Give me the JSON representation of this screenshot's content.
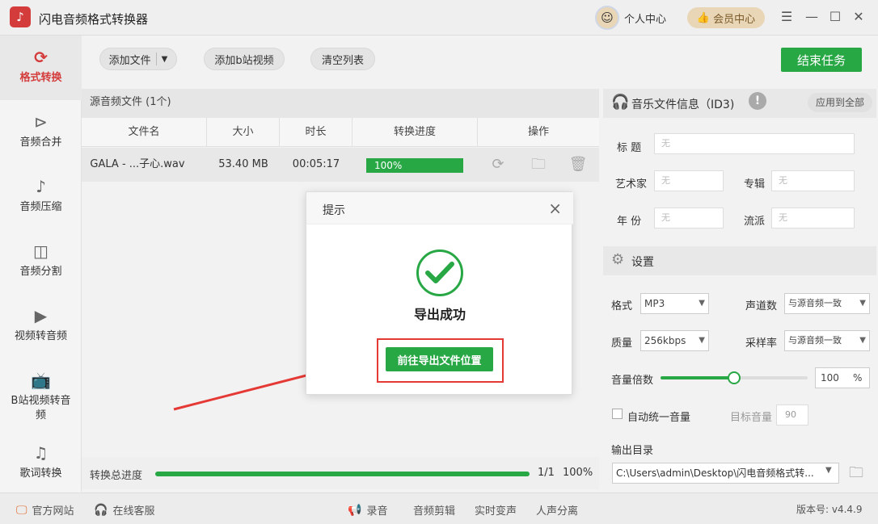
{
  "app": {
    "title": "闪电音频格式转换器",
    "user_center": "个人中心",
    "vip": "会员中心"
  },
  "sidebar": {
    "items": [
      {
        "label": "格式转换"
      },
      {
        "label": "音频合并"
      },
      {
        "label": "音频压缩"
      },
      {
        "label": "音频分割"
      },
      {
        "label": "视频转音频"
      },
      {
        "label": "B站视频转音频"
      },
      {
        "label": "歌词转换"
      }
    ]
  },
  "toolbar": {
    "add_file": "添加文件",
    "add_bilibili": "添加b站视频",
    "clear_list": "清空列表",
    "finish_task": "结束任务"
  },
  "filelist": {
    "header": "源音频文件 (1个)",
    "columns": [
      "文件名",
      "大小",
      "时长",
      "转换进度",
      "操作"
    ],
    "rows": [
      {
        "name": "GALA - ...子心.wav",
        "size": "53.40 MB",
        "duration": "00:05:17",
        "progress": 1.0,
        "progress_label": "100%"
      }
    ]
  },
  "overall": {
    "label": "转换总进度",
    "progress": 1.0,
    "count": "1/1",
    "percent": "100%"
  },
  "id3": {
    "title": "音乐文件信息（ID3)",
    "apply_all": "应用到全部",
    "fields": {
      "title_label": "标 题",
      "artist_label": "艺术家",
      "album_label": "专辑",
      "year_label": "年 份",
      "genre_label": "流派",
      "empty": "无"
    }
  },
  "settings": {
    "title": "设置",
    "format_label": "格式",
    "format_value": "MP3",
    "channels_label": "声道数",
    "channels_value": "与源音频一致",
    "quality_label": "质量",
    "quality_value": "256kbps",
    "samplerate_label": "采样率",
    "samplerate_value": "与源音频一致",
    "volume_label": "音量倍数",
    "volume_value": "100",
    "volume_unit": "%",
    "volume_level": 0.5,
    "auto_volume_label": "自动统一音量",
    "target_volume_label": "目标音量",
    "target_volume_value": "90",
    "output_dir_label": "输出目录",
    "output_dir_value": "C:\\Users\\admin\\Desktop\\闪电音频格式转..."
  },
  "statusbar": {
    "website": "官方网站",
    "service": "在线客服",
    "record": "录音",
    "edit": "音频剪辑",
    "voice_change": "实时变声",
    "vocal_sep": "人声分离",
    "version": "版本号: v4.4.9"
  },
  "dialog": {
    "title": "提示",
    "message": "导出成功",
    "button": "前往导出文件位置"
  },
  "colors": {
    "accent": "#28a745",
    "brand_red": "#d43c3c",
    "highlight": "#e53935"
  }
}
